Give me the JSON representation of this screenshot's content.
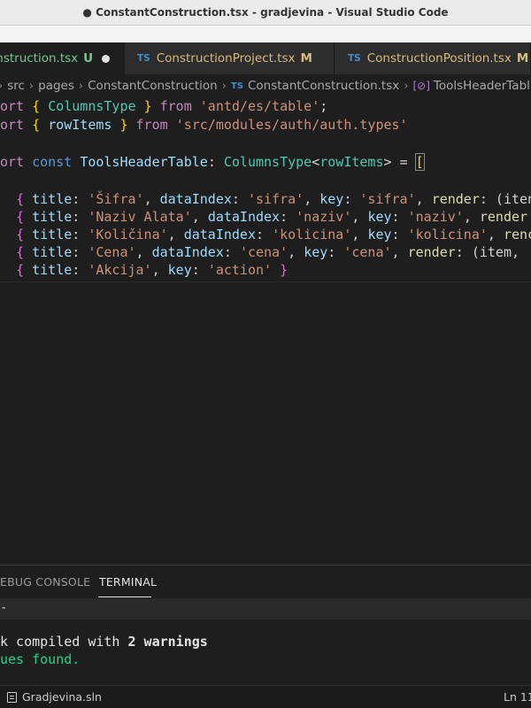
{
  "window": {
    "title": "● ConstantConstruction.tsx - gradjevina - Visual Studio Code"
  },
  "tabs": [
    {
      "name": "onstruction.tsx",
      "badge": "U",
      "type_icon": ""
    },
    {
      "name": "ConstructionProject.tsx",
      "badge": "M",
      "type_icon": "TS"
    },
    {
      "name": "ConstructionPosition.tsx",
      "badge": "M",
      "type_icon": "TS"
    }
  ],
  "breadcrumb": {
    "items": [
      "src",
      "pages",
      "ConstantConstruction",
      "ConstantConstruction.tsx",
      "ToolsHeaderTabl"
    ],
    "file_icon": "TS",
    "symbol_icon": "variable-icon"
  },
  "code": {
    "l1": {
      "a": "ort",
      "b": "{",
      "c": "ColumnsType",
      "d": "}",
      "e": "from",
      "f": "'antd/es/table'",
      "g": ";"
    },
    "l2": {
      "a": "ort",
      "b": "{",
      "c": "rowItems",
      "d": "}",
      "e": "from",
      "f": "'src/modules/auth/auth.types'"
    },
    "l4": {
      "a": "ort",
      "b": "const",
      "c": "ToolsHeaderTable",
      "d": ":",
      "e": "ColumnsType",
      "f": "<",
      "g": "rowItems",
      "h": ">",
      "i": "=",
      "j": "["
    },
    "rows": [
      {
        "o": "{",
        "k1": "title",
        "v1": "'Šifra'",
        "k2": "dataIndex",
        "v2": "'sifra'",
        "k3": "key",
        "v3": "'sifra'",
        "k4": "render",
        "tail": ": (iten"
      },
      {
        "o": "{",
        "k1": "title",
        "v1": "'Naziv Alata'",
        "k2": "dataIndex",
        "v2": "'naziv'",
        "k3": "key",
        "v3": "'naziv'",
        "k4": "render",
        "tail": ""
      },
      {
        "o": "{",
        "k1": "title",
        "v1": "'Količina'",
        "k2": "dataIndex",
        "v2": "'kolicina'",
        "k3": "key",
        "v3": "'kolicina'",
        "k4": "renc",
        "tail": ""
      },
      {
        "o": "{",
        "k1": "title",
        "v1": "'Cena'",
        "k2": "dataIndex",
        "v2": "'cena'",
        "k3": "key",
        "v3": "'cena'",
        "k4": "render",
        "tail": ": (item,"
      }
    ],
    "last": {
      "o": "{",
      "k1": "title",
      "v1": "'Akcija'",
      "k2": "key",
      "v2": "'action'",
      "c": "}"
    }
  },
  "panel": {
    "tabs": [
      "EBUG CONSOLE",
      "TERMINAL"
    ],
    "active_tab": "TERMINAL",
    "prompt": "-",
    "output": {
      "l1_pre": "k compiled with ",
      "l1_bold": "2 warnings",
      "l2": "ues found."
    }
  },
  "status": {
    "solution": "Gradjevina.sln",
    "position": "Ln 11"
  }
}
